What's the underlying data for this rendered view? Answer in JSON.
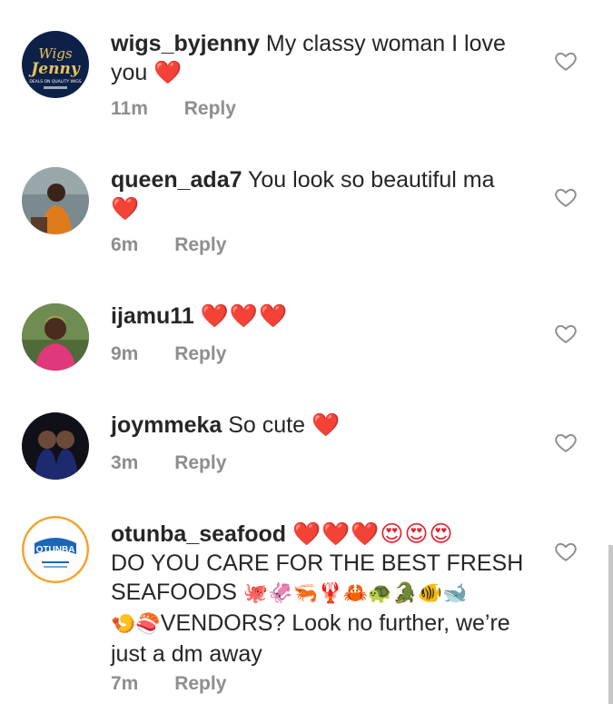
{
  "comments": [
    {
      "username": "wigs_byjenny",
      "text": "My classy woman I love you",
      "emoji": "❤️",
      "time": "11m",
      "reply": "Reply",
      "avatar_text": {
        "line1": "Wigs",
        "line2": "Jenny",
        "line3": "DEALS ON QUALITY WIGS"
      }
    },
    {
      "username": "queen_ada7",
      "text": "You look so beautiful ma",
      "emoji": "❤️",
      "time": "6m",
      "reply": "Reply"
    },
    {
      "username": "ijamu11",
      "text": "",
      "emoji": "❤️❤️❤️",
      "time": "9m",
      "reply": "Reply"
    },
    {
      "username": "joymmeka",
      "text": "So cute",
      "emoji": "❤️",
      "time": "3m",
      "reply": "Reply"
    },
    {
      "username": "otunba_seafood",
      "emoji": "❤️❤️❤️😍😍😍",
      "text_line1": "DO YOU CARE FOR THE BEST FRESH",
      "text_line2": "SEAFOODS",
      "emoji_line2": "🐙🦑🦐🦞🦀🐢🐊🐠🐋",
      "emoji_line3": "🍤🍣",
      "text_line3": "VENDORS? Look no further, we’re",
      "text_line4": "just a dm away",
      "time": "7m",
      "reply": "Reply",
      "avatar_text": {
        "line1": "OTUNBA"
      }
    }
  ],
  "colors": {
    "text": "#262626",
    "meta": "#8e8e8e",
    "heart": "#e0202f",
    "seafood_ring": "#f4a32a"
  },
  "icons": {
    "like": "heart-outline-icon"
  }
}
